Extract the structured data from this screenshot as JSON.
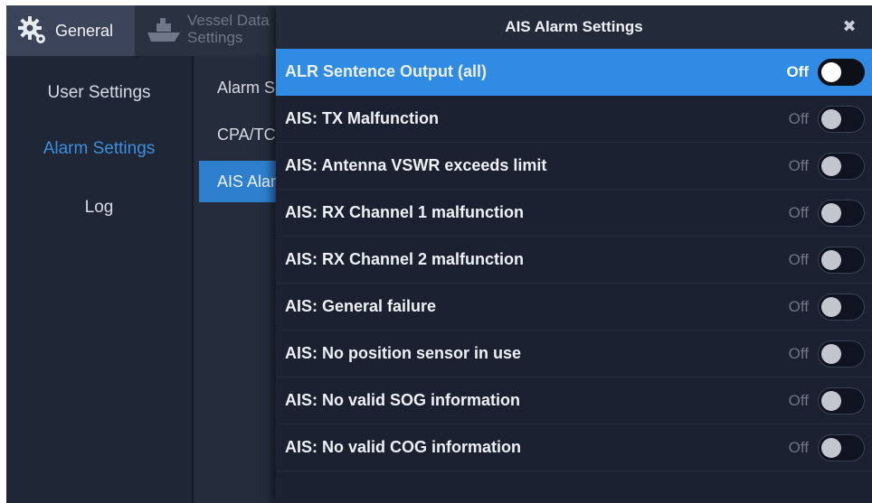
{
  "tabs": {
    "general_label": "General",
    "vessel_label_line1": "Vessel Data",
    "vessel_label_line2": "Settings"
  },
  "sidebar": {
    "items": [
      {
        "label": "User Settings",
        "active": false
      },
      {
        "label": "Alarm Settings",
        "active": true
      },
      {
        "label": "Log",
        "active": false
      }
    ]
  },
  "submenu": {
    "items": [
      {
        "label": "Alarm Settings",
        "active": false
      },
      {
        "label": "CPA/TCPA",
        "active": false
      },
      {
        "label": "AIS Alarm",
        "active": true
      }
    ]
  },
  "dialog": {
    "title": "AIS Alarm Settings",
    "close_icon": "close-icon",
    "rows": [
      {
        "label": "ALR Sentence Output (all)",
        "state": "Off",
        "highlight": true
      },
      {
        "label": "AIS: TX Malfunction",
        "state": "Off",
        "highlight": false
      },
      {
        "label": "AIS: Antenna VSWR exceeds limit",
        "state": "Off",
        "highlight": false
      },
      {
        "label": "AIS: RX Channel 1 malfunction",
        "state": "Off",
        "highlight": false
      },
      {
        "label": "AIS: RX Channel 2 malfunction",
        "state": "Off",
        "highlight": false
      },
      {
        "label": "AIS: General failure",
        "state": "Off",
        "highlight": false
      },
      {
        "label": "AIS: No position sensor in use",
        "state": "Off",
        "highlight": false
      },
      {
        "label": "AIS: No valid SOG information",
        "state": "Off",
        "highlight": false
      },
      {
        "label": "AIS: No valid COG information",
        "state": "Off",
        "highlight": false
      }
    ]
  },
  "colors": {
    "accent": "#2f8be3",
    "active_text": "#3c8fdc",
    "background": "#1e2535"
  }
}
